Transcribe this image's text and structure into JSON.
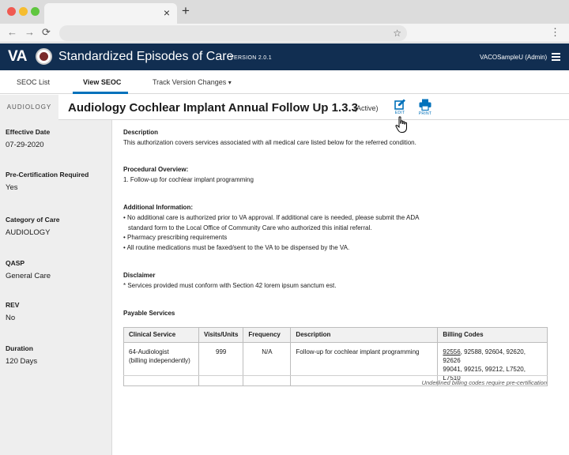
{
  "browser": {
    "tab_close": "×",
    "new_tab": "+",
    "nav": {
      "back": "←",
      "forward": "→",
      "reload": "⟳"
    },
    "star": "☆",
    "menu": "⋮"
  },
  "header": {
    "logo": "VA",
    "title": "Standardized Episodes of Care",
    "version": "VERSION 2.0.1",
    "user": "VACOSampleU (Admin)",
    "colors": {
      "background": "#112e51"
    }
  },
  "subnav": {
    "tabs": [
      {
        "label": "SEOC List"
      },
      {
        "label": "View SEOC",
        "active": true
      },
      {
        "label": "Track Version Changes",
        "chevron": "▾"
      }
    ],
    "accent": "#0071bb"
  },
  "seoc": {
    "category": "AUDIOLOGY",
    "title": "Audiology Cochlear Implant Annual Follow Up 1.3.3",
    "status": "(Active)",
    "actions": {
      "edit": "EDIT",
      "print": "PRINT"
    }
  },
  "sidebar": {
    "items": [
      {
        "label": "Effective Date",
        "value": "07-29-2020"
      },
      {
        "label": "Pre-Certification Required",
        "value": "Yes"
      },
      {
        "label": "Category of Care",
        "value": "AUDIOLOGY"
      },
      {
        "label": "QASP",
        "value": "General Care"
      },
      {
        "label": "REV",
        "value": "No"
      },
      {
        "label": "Duration",
        "value": "120 Days"
      }
    ]
  },
  "main": {
    "description": {
      "title": "Description",
      "text": "This authorization covers services associated with all medical care listed below for the referred condition."
    },
    "procedural": {
      "title": "Procedural Overview:",
      "text": "1. Follow-up for cochlear implant programming"
    },
    "additional": {
      "title": "Additional Information:",
      "lines": [
        "• No additional care is authorized prior to VA approval. If additional care is needed, please submit the ADA",
        "standard form to the Local Office of Community Care who authorized this initial referral.",
        "• Pharmacy prescribing requirements",
        "• All routine medications must be faxed/sent to the VA to be dispensed by the VA."
      ]
    },
    "disclaimer": {
      "title": "Disclaimer",
      "text": "* Services provided must conform with Section 42 lorem ipsum sanctum est."
    },
    "payable": {
      "title": "Payable Services",
      "columns": [
        "Clinical Service",
        "Visits/Units",
        "Frequency",
        "Description",
        "Billing Codes"
      ],
      "row": {
        "service_line1": "64-Audiologist",
        "service_line2": "(billing independently)",
        "visits": "999",
        "frequency": "N/A",
        "description": "Follow-up for cochlear implant programming",
        "codes_underlined": "92556",
        "codes_line1_rest": ", 92588, 92604, 92620, 92626",
        "codes_line2": "99041, 99215, 99212, L7520, L7510"
      },
      "footnote": "Underlined billing codes require pre-certification"
    }
  }
}
